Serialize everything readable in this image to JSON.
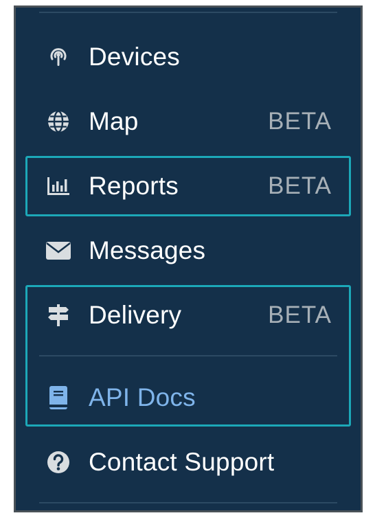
{
  "nav": {
    "items": [
      {
        "label": "Devices",
        "icon": "radio-signal-icon"
      },
      {
        "label": "Map",
        "icon": "globe-icon",
        "badge": "BETA"
      },
      {
        "label": "Reports",
        "icon": "bar-chart-icon",
        "badge": "BETA"
      },
      {
        "label": "Messages",
        "icon": "envelope-icon"
      },
      {
        "label": "Delivery",
        "icon": "signpost-icon",
        "badge": "BETA"
      },
      {
        "label": "API Docs",
        "icon": "book-icon"
      },
      {
        "label": "Contact Support",
        "icon": "question-circle-icon"
      }
    ]
  },
  "colors": {
    "panel_bg": "#14304a",
    "text": "#ffffff",
    "badge": "#a7b0b7",
    "link": "#7fb4ea",
    "highlight": "#1ca8b8"
  }
}
